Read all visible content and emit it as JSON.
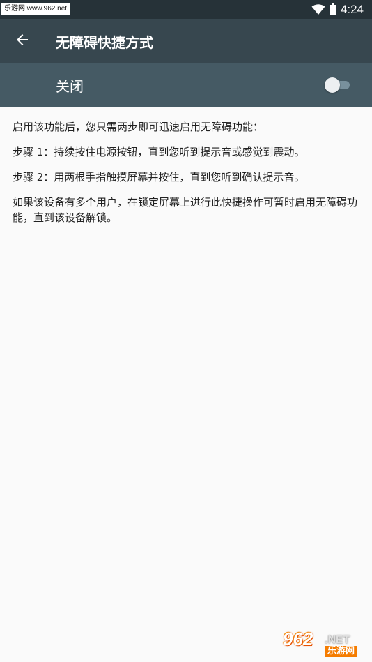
{
  "status_bar": {
    "watermark": "乐游网 www.962.net",
    "time": "4:24"
  },
  "app_bar": {
    "back_icon": "arrow-left-icon",
    "title": "无障碍快捷方式"
  },
  "switch_bar": {
    "label": "关闭",
    "enabled": false
  },
  "content": {
    "paragraphs": [
      "启用该功能后，您只需两步即可迅速启用无障碍功能：",
      "步骤 1：持续按住电源按钮，直到您听到提示音或感觉到震动。",
      "步骤 2：用两根手指触摸屏幕并按住，直到您听到确认提示音。",
      "如果该设备有多个用户，在锁定屏幕上进行此快捷操作可暂时启用无障碍功能，直到该设备解锁。"
    ]
  },
  "watermark_bottom": {
    "digits": "962",
    "suffix": ".NET",
    "cn": "乐游网"
  },
  "colors": {
    "status_bar": "#263238",
    "app_bar": "#37474f",
    "switch_bar": "#455a64",
    "background": "#fafafa"
  }
}
